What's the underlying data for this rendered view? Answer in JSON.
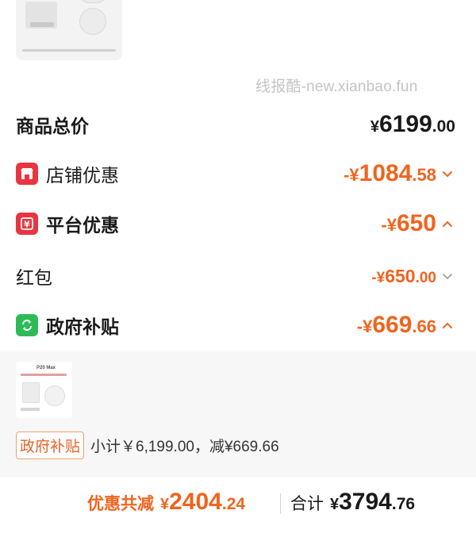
{
  "watermark": "线报酷-new.xianbao.fun",
  "summary": {
    "goods_total": {
      "label": "商品总价",
      "currency": "¥",
      "int": "6199",
      "dec": ".00"
    },
    "store_discount": {
      "label": "店铺优惠",
      "currency": "-¥",
      "int": "1084",
      "dec": ".58",
      "icon": "store-icon",
      "chevron": "down"
    },
    "platform_discount": {
      "label": "平台优惠",
      "currency": "-¥",
      "int": "650",
      "dec": "",
      "icon": "yuan-coupon-icon",
      "chevron": "up"
    },
    "red_packet": {
      "label": "红包",
      "currency": "-¥",
      "int": "650",
      "dec": ".00",
      "chevron": "down"
    },
    "gov_subsidy": {
      "label": "政府补贴",
      "currency": "-¥",
      "int": "669",
      "dec": ".66",
      "icon": "recycle-icon",
      "chevron": "up"
    }
  },
  "product": {
    "thumb_title": "P20 Max",
    "subsidy_tag": "政府补贴",
    "subtotal_text": "小计￥6,199.00，减¥669.66"
  },
  "bottom": {
    "discount_label": "优惠共减",
    "discount_currency": "¥",
    "discount_int": "2404",
    "discount_dec": ".24",
    "total_label": "合计",
    "total_currency": "¥",
    "total_int": "3794",
    "total_dec": ".76"
  },
  "colors": {
    "accent_orange": "#f0641e",
    "icon_red": "#e8353f",
    "icon_green": "#2dbb5a"
  }
}
